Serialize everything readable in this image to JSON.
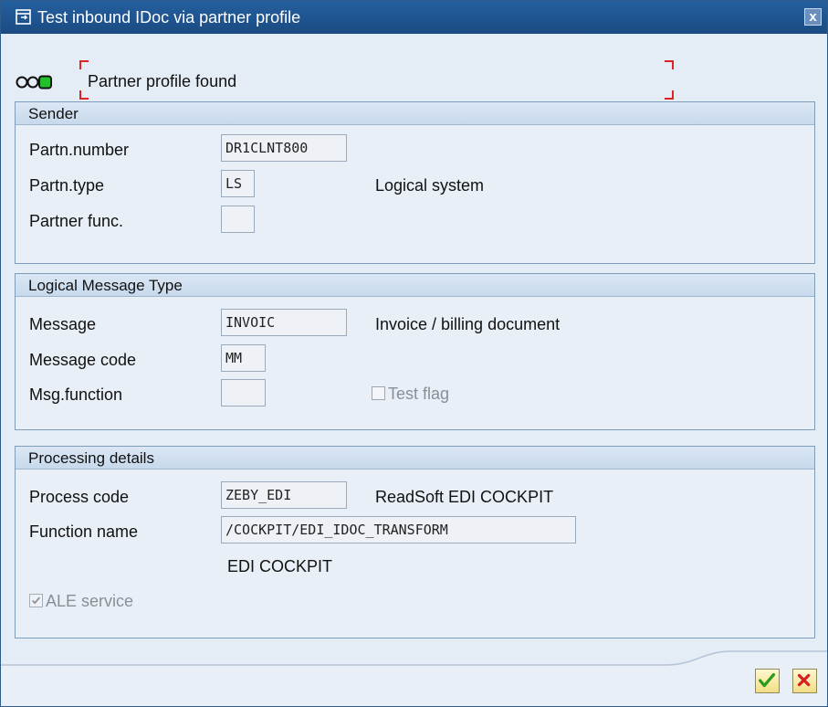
{
  "window": {
    "title": "Test inbound IDoc via partner profile",
    "close_label": "x"
  },
  "status": {
    "message": "Partner profile found"
  },
  "sender": {
    "header": "Sender",
    "partn_number_label": "Partn.number",
    "partn_number_value": "DR1CLNT800",
    "partn_type_label": "Partn.type",
    "partn_type_value": "LS",
    "partn_type_desc": "Logical system",
    "partner_func_label": "Partner func.",
    "partner_func_value": ""
  },
  "message_type": {
    "header": "Logical Message Type",
    "message_label": "Message",
    "message_value": "INVOIC",
    "message_desc": "Invoice / billing document",
    "message_code_label": "Message code",
    "message_code_value": "MM",
    "msg_function_label": "Msg.function",
    "msg_function_value": "",
    "test_flag_label": "Test flag",
    "test_flag_checked": false
  },
  "processing": {
    "header": "Processing details",
    "process_code_label": "Process code",
    "process_code_value": "ZEBY_EDI",
    "process_code_desc": "ReadSoft EDI COCKPIT",
    "function_name_label": "Function name",
    "function_name_value": "/COCKPIT/EDI_IDOC_TRANSFORM",
    "function_desc": "EDI COCKPIT",
    "ale_service_label": "ALE service",
    "ale_service_checked": true
  },
  "colors": {
    "titlebar": "#1f5592",
    "panel_bg": "#e8eff7",
    "status_green": "#22c02a",
    "bracket_red": "#e02222",
    "ok_check": "#2c9a1a",
    "cancel_x": "#d42020"
  },
  "icons": {
    "title": "dialog-window-icon",
    "status": "traffic-light-green-icon",
    "ok": "checkmark-icon",
    "cancel": "cross-icon"
  }
}
